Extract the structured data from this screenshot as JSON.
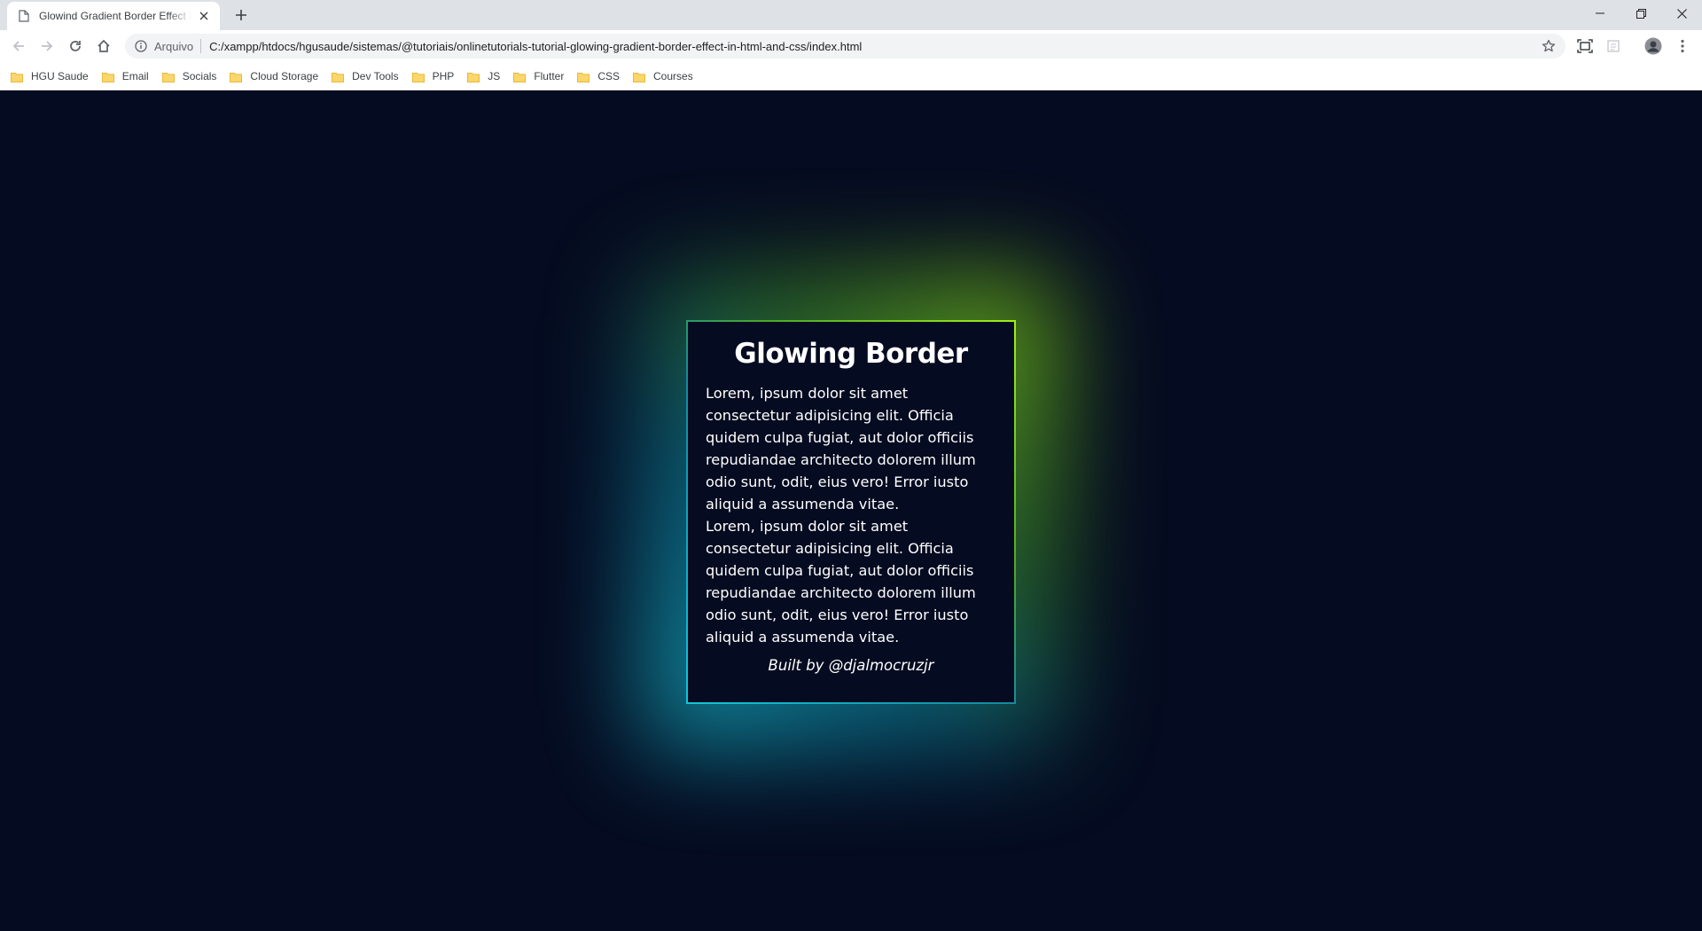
{
  "browser": {
    "tab_title": "Glowind Gradient Border Effect in HTML and CSS",
    "address_chip": "Arquivo",
    "url": "C:/xampp/htdocs/hgusaude/sistemas/@tutoriais/onlinetutorials-tutorial-glowing-gradient-border-effect-in-html-and-css/index.html",
    "bookmarks": [
      {
        "label": "HGU Saude"
      },
      {
        "label": "Email"
      },
      {
        "label": "Socials"
      },
      {
        "label": "Cloud Storage"
      },
      {
        "label": "Dev Tools"
      },
      {
        "label": "PHP"
      },
      {
        "label": "JS"
      },
      {
        "label": "Flutter"
      },
      {
        "label": "CSS"
      },
      {
        "label": "Courses"
      }
    ]
  },
  "page": {
    "title": "Glowing Border",
    "paragraph_1": "Lorem, ipsum dolor sit amet consectetur adipisicing elit. Officia quidem culpa fugiat, aut dolor officiis repudiandae architecto dolorem illum odio sunt, odit, eius vero! Error iusto aliquid a assumenda vitae.",
    "paragraph_2": "Lorem, ipsum dolor sit amet consectetur adipisicing elit. Officia quidem culpa fugiat, aut dolor officiis repudiandae architecto dolorem illum odio sunt, odit, eius vero! Error iusto aliquid a assumenda vitae.",
    "credit": "Built by @djalmocruzjr"
  },
  "colors": {
    "page_background": "#050b20",
    "gradient_start": "#12c6dd",
    "gradient_end": "#9ef01a"
  }
}
